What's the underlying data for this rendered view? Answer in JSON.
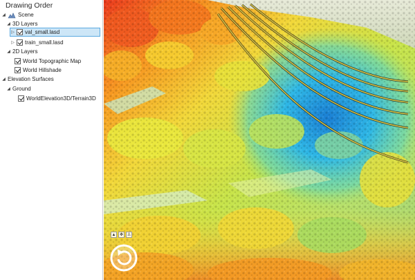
{
  "contents": {
    "title": "Drawing Order",
    "scene": {
      "label": "Scene",
      "icon": "scene-icon"
    },
    "groups": [
      {
        "id": "3d",
        "label": "3D Layers"
      },
      {
        "id": "2d",
        "label": "2D Layers"
      },
      {
        "id": "elev",
        "label": "Elevation Surfaces"
      }
    ],
    "layers_3d": [
      {
        "label": "val_small.lasd",
        "checked": true,
        "selected": true
      },
      {
        "label": "train_small.lasd",
        "checked": true,
        "selected": false
      }
    ],
    "layers_2d": [
      {
        "label": "World Topographic Map",
        "checked": true
      },
      {
        "label": "World Hillshade",
        "checked": true
      }
    ],
    "ground": {
      "label": "Ground"
    },
    "elevation_layers": [
      {
        "label": "WorldElevation3D/Terrain3D",
        "checked": true
      }
    ]
  },
  "map": {
    "description_icon": "lidar-point-cloud-view",
    "nav_small_icons": [
      "up-arrow-icon",
      "full-extent-icon",
      "person-icon"
    ],
    "nav_wheel_icon": "rotate-arrow-icon",
    "colors": {
      "high": "#e8281e",
      "mid_high": "#f5a623",
      "mid": "#e6e63a",
      "low_mid": "#79d36b",
      "low": "#2fb6e8",
      "lowest": "#1f86d6",
      "powerline": "#c8b23a"
    }
  }
}
